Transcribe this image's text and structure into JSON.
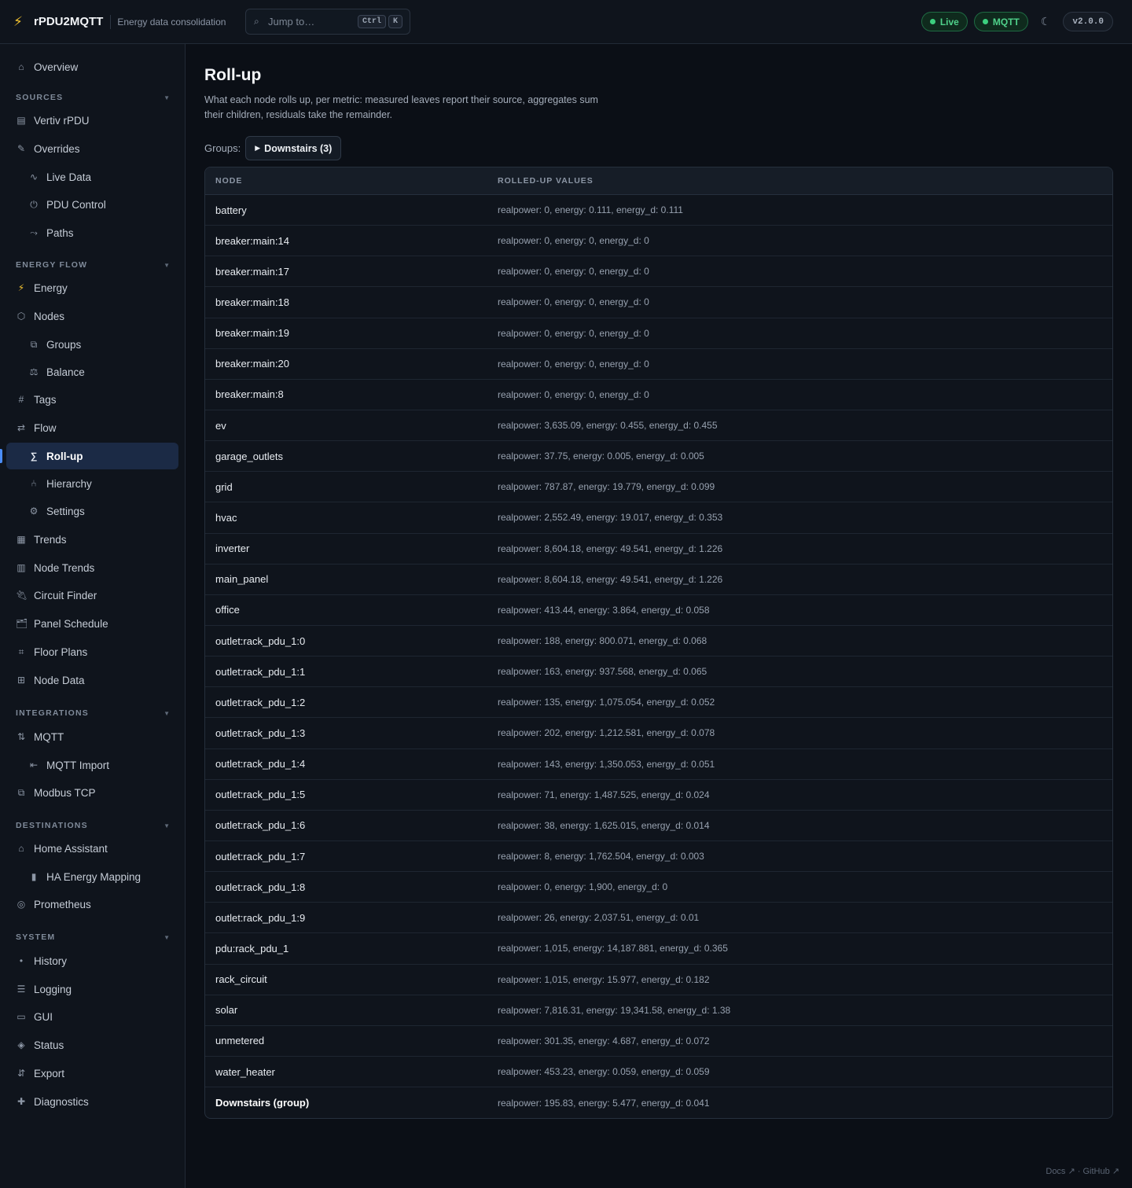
{
  "header": {
    "app_name": "rPDU2MQTT",
    "subtitle": "Energy data consolidation",
    "search_placeholder": "Jump to…",
    "kbd_ctrl": "Ctrl",
    "kbd_k": "K",
    "live_label": "Live",
    "mqtt_label": "MQTT",
    "version": "v2.0.0",
    "status_color": "#3ccf7e"
  },
  "sidebar": {
    "overview": "Overview",
    "sections": {
      "sources": "SOURCES",
      "energy_flow": "ENERGY FLOW",
      "integrations": "INTEGRATIONS",
      "destinations": "DESTINATIONS",
      "system": "SYSTEM"
    },
    "items": {
      "vertiv": "Vertiv rPDU",
      "overrides": "Overrides",
      "live_data": "Live Data",
      "pdu_control": "PDU Control",
      "paths": "Paths",
      "energy": "Energy",
      "nodes": "Nodes",
      "groups": "Groups",
      "balance": "Balance",
      "tags": "Tags",
      "flow": "Flow",
      "rollup": "Roll-up",
      "hierarchy": "Hierarchy",
      "settings": "Settings",
      "trends": "Trends",
      "node_trends": "Node Trends",
      "circuit_finder": "Circuit Finder",
      "panel_schedule": "Panel Schedule",
      "floor_plans": "Floor Plans",
      "node_data": "Node Data",
      "mqtt": "MQTT",
      "mqtt_import": "MQTT Import",
      "modbus": "Modbus TCP",
      "home_assistant": "Home Assistant",
      "ha_energy": "HA Energy Mapping",
      "prometheus": "Prometheus",
      "history": "History",
      "logging": "Logging",
      "gui": "GUI",
      "status": "Status",
      "export": "Export",
      "diagnostics": "Diagnostics"
    }
  },
  "main": {
    "title": "Roll-up",
    "description": "What each node rolls up, per metric: measured leaves report their source, aggregates sum their children, residuals take the remainder.",
    "groups_label": "Groups:",
    "group_button": "Downstairs (3)",
    "table": {
      "headers": [
        "NODE",
        "ROLLED-UP VALUES"
      ],
      "rows": [
        [
          "battery",
          "realpower: 0, energy: 0.111, energy_d: 0.111"
        ],
        [
          "breaker:main:14",
          "realpower: 0, energy: 0, energy_d: 0"
        ],
        [
          "breaker:main:17",
          "realpower: 0, energy: 0, energy_d: 0"
        ],
        [
          "breaker:main:18",
          "realpower: 0, energy: 0, energy_d: 0"
        ],
        [
          "breaker:main:19",
          "realpower: 0, energy: 0, energy_d: 0"
        ],
        [
          "breaker:main:20",
          "realpower: 0, energy: 0, energy_d: 0"
        ],
        [
          "breaker:main:8",
          "realpower: 0, energy: 0, energy_d: 0"
        ],
        [
          "ev",
          "realpower: 3,635.09, energy: 0.455, energy_d: 0.455"
        ],
        [
          "garage_outlets",
          "realpower: 37.75, energy: 0.005, energy_d: 0.005"
        ],
        [
          "grid",
          "realpower: 787.87, energy: 19.779, energy_d: 0.099"
        ],
        [
          "hvac",
          "realpower: 2,552.49, energy: 19.017, energy_d: 0.353"
        ],
        [
          "inverter",
          "realpower: 8,604.18, energy: 49.541, energy_d: 1.226"
        ],
        [
          "main_panel",
          "realpower: 8,604.18, energy: 49.541, energy_d: 1.226"
        ],
        [
          "office",
          "realpower: 413.44, energy: 3.864, energy_d: 0.058"
        ],
        [
          "outlet:rack_pdu_1:0",
          "realpower: 188, energy: 800.071, energy_d: 0.068"
        ],
        [
          "outlet:rack_pdu_1:1",
          "realpower: 163, energy: 937.568, energy_d: 0.065"
        ],
        [
          "outlet:rack_pdu_1:2",
          "realpower: 135, energy: 1,075.054, energy_d: 0.052"
        ],
        [
          "outlet:rack_pdu_1:3",
          "realpower: 202, energy: 1,212.581, energy_d: 0.078"
        ],
        [
          "outlet:rack_pdu_1:4",
          "realpower: 143, energy: 1,350.053, energy_d: 0.051"
        ],
        [
          "outlet:rack_pdu_1:5",
          "realpower: 71, energy: 1,487.525, energy_d: 0.024"
        ],
        [
          "outlet:rack_pdu_1:6",
          "realpower: 38, energy: 1,625.015, energy_d: 0.014"
        ],
        [
          "outlet:rack_pdu_1:7",
          "realpower: 8, energy: 1,762.504, energy_d: 0.003"
        ],
        [
          "outlet:rack_pdu_1:8",
          "realpower: 0, energy: 1,900, energy_d: 0"
        ],
        [
          "outlet:rack_pdu_1:9",
          "realpower: 26, energy: 2,037.51, energy_d: 0.01"
        ],
        [
          "pdu:rack_pdu_1",
          "realpower: 1,015, energy: 14,187.881, energy_d: 0.365"
        ],
        [
          "rack_circuit",
          "realpower: 1,015, energy: 15.977, energy_d: 0.182"
        ],
        [
          "solar",
          "realpower: 7,816.31, energy: 19,341.58, energy_d: 1.38"
        ],
        [
          "unmetered",
          "realpower: 301.35, energy: 4.687, energy_d: 0.072"
        ],
        [
          "water_heater",
          "realpower: 453.23, energy: 0.059, energy_d: 0.059"
        ]
      ],
      "group_row": [
        "Downstairs (group)",
        "realpower: 195.83, energy: 5.477, energy_d: 0.041"
      ]
    }
  },
  "footer": {
    "links": "Docs ↗ · GitHub ↗"
  }
}
